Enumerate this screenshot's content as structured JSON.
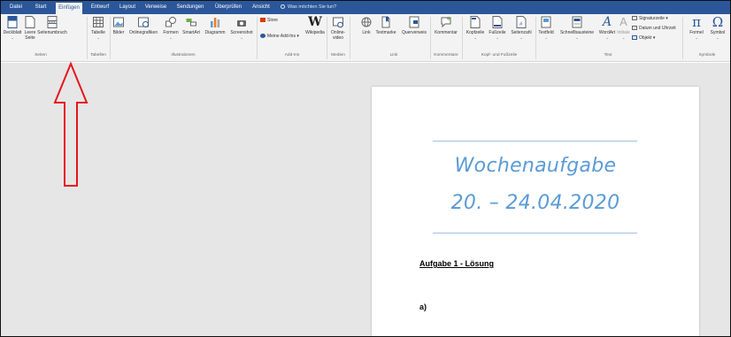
{
  "ribbon_tabs": [
    {
      "label": "Datei"
    },
    {
      "label": "Start"
    },
    {
      "label": "Einfügen"
    },
    {
      "label": "Entwurf"
    },
    {
      "label": "Layout"
    },
    {
      "label": "Verweise"
    },
    {
      "label": "Sendungen"
    },
    {
      "label": "Überprüfen"
    },
    {
      "label": "Ansicht"
    }
  ],
  "active_tab": "Einfügen",
  "tell_me": "Was möchten Sie tun?",
  "buttons": {
    "deckblatt": "Deckblatt",
    "leere_seite": "Leere",
    "leere_seite_2": "Seite",
    "seitenumbruch": "Seitenumbruch",
    "tabelle": "Tabelle",
    "bilder": "Bilder",
    "onlinegrafiken": "Onlinegrafiken",
    "formen": "Formen",
    "smartart": "SmartArt",
    "diagramm": "Diagramm",
    "screenshot": "Screenshot",
    "store": "Store",
    "meine_addins": "Meine Add-Ins",
    "wikipedia": "Wikipedia",
    "onlinevideo_1": "Online-",
    "onlinevideo_2": "video",
    "link": "Link",
    "textmarke": "Textmarke",
    "querverweis": "Querverweis",
    "kommentar": "Kommentar",
    "kopfzeile": "Kopfzeile",
    "fusszeile": "Fußzeile",
    "seitenzahl": "Seitenzahl",
    "textfeld": "Textfeld",
    "schnellbausteine": "Schnellbausteine",
    "wordart": "WordArt",
    "initiale": "Initiale",
    "signaturzeile": "Signaturzeile",
    "datum_uhrzeit": "Datum und Uhrzeit",
    "objekt": "Objekt",
    "formel": "Formel",
    "symbol": "Symbol"
  },
  "groups": {
    "seiten": "Seiten",
    "tabellen": "Tabellen",
    "illustrationen": "Illustrationen",
    "addins": "Add-Ins",
    "medien": "Medien",
    "link": "Link",
    "kommentare": "Kommentare",
    "kopf_fuss": "Kopf- und Fußzeile",
    "text": "Text",
    "symbole": "Symbole"
  },
  "document": {
    "title_line1": "Wochenaufgabe",
    "title_line2": "20. – 24.04.2020",
    "heading": "Aufgabe 1 - Lösung",
    "item_a": "a)"
  },
  "colors": {
    "ribbon_blue": "#2b579a",
    "title_blue": "#5b9bd5",
    "annotation_red": "#e8141c"
  }
}
